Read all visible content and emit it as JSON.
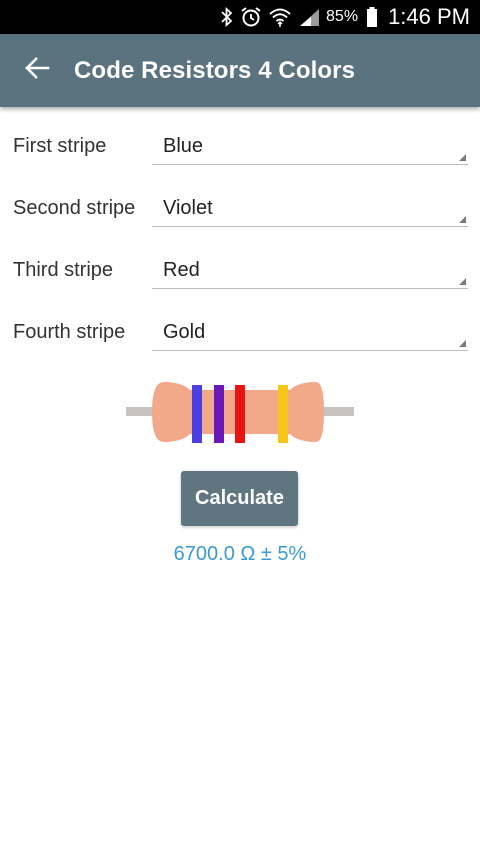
{
  "status_bar": {
    "battery_percent": "85%",
    "time": "1:46 PM"
  },
  "app_bar": {
    "title": "Code Resistors 4 Colors"
  },
  "stripes": [
    {
      "label": "First stripe",
      "value": "Blue"
    },
    {
      "label": "Second stripe",
      "value": "Violet"
    },
    {
      "label": "Third stripe",
      "value": "Red"
    },
    {
      "label": "Fourth stripe",
      "value": "Gold"
    }
  ],
  "resistor": {
    "body_color": "#f2a98a",
    "lead_color": "#c8c2c2",
    "band_colors": [
      "#4a3fe0",
      "#6c18b8",
      "#e81414",
      "#f5c518"
    ]
  },
  "actions": {
    "calculate_label": "Calculate"
  },
  "result": {
    "text": "6700.0 Ω ± 5%"
  },
  "colors": {
    "app_bar": "#5b737e",
    "button": "#5f7681",
    "result": "#3a9bd1"
  },
  "icons": {
    "status": [
      "bluetooth-icon",
      "alarm-icon",
      "wifi-icon",
      "signal-icon",
      "battery-icon"
    ],
    "app_bar": "back-arrow-icon"
  }
}
